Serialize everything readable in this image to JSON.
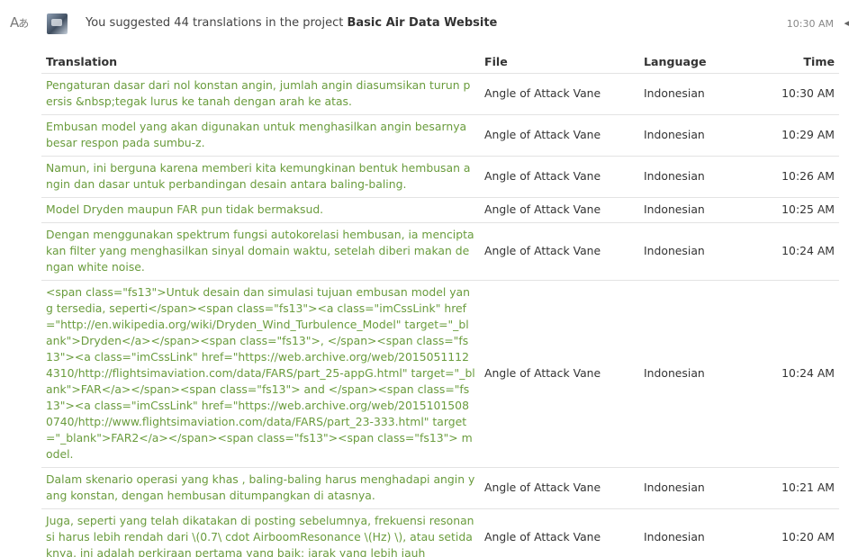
{
  "header": {
    "translate_icon_glyph_a": "A",
    "translate_icon_glyph_b": "あ",
    "headline_prefix": "You suggested 44 translations in the project ",
    "project_name": "Basic Air Data Website",
    "time": "10:30 AM"
  },
  "table": {
    "columns": {
      "translation": "Translation",
      "file": "File",
      "language": "Language",
      "time": "Time"
    },
    "rows": [
      {
        "translation": "Pengaturan dasar dari nol konstan angin, jumlah angin diasumsikan turun persis &nbsp;tegak lurus ke tanah dengan arah ke atas.",
        "file": "Angle of Attack Vane",
        "language": "Indonesian",
        "time": "10:30 AM"
      },
      {
        "translation": "Embusan model yang akan digunakan untuk menghasilkan angin besarnya besar respon pada sumbu-z.",
        "file": "Angle of Attack Vane",
        "language": "Indonesian",
        "time": "10:29 AM"
      },
      {
        "translation": "Namun, ini berguna karena memberi kita kemungkinan bentuk hembusan angin dan dasar untuk perbandingan desain antara baling-baling.",
        "file": "Angle of Attack Vane",
        "language": "Indonesian",
        "time": "10:26 AM"
      },
      {
        "translation": "Model Dryden maupun FAR pun tidak bermaksud.",
        "file": "Angle of Attack Vane",
        "language": "Indonesian",
        "time": "10:25 AM"
      },
      {
        "translation": "Dengan menggunakan spektrum fungsi autokorelasi hembusan, ia menciptakan filter yang menghasilkan sinyal domain waktu, setelah diberi makan dengan white noise.",
        "file": "Angle of Attack Vane",
        "language": "Indonesian",
        "time": "10:24 AM"
      },
      {
        "translation": "<span class=\"fs13\">Untuk desain dan simulasi tujuan embusan model yang tersedia, seperti</span><span class=\"fs13\"><a class=\"imCssLink\" href=\"http://en.wikipedia.org/wiki/Dryden_Wind_Turbulence_Model\" target=\"_blank\">Dryden</a></span><span class=\"fs13\">, </span><span class=\"fs13\"><a class=\"imCssLink\" href=\"https://web.archive.org/web/20150511124310/http://flightsimaviation.com/data/FARS/part_25-appG.html\" target=\"_blank\">FAR</a></span><span class=\"fs13\"> and </span><span class=\"fs13\"><a class=\"imCssLink\" href=\"https://web.archive.org/web/20151015080740/http://www.flightsimaviation.com/data/FARS/part_23-333.html\" target=\"_blank\">FAR2</a></span><span class=\"fs13\"><span class=\"fs13\"> model.",
        "file": "Angle of Attack Vane",
        "language": "Indonesian",
        "time": "10:24 AM"
      },
      {
        "translation": "Dalam skenario operasi yang khas , baling-baling harus menghadapi angin yang konstan, dengan hembusan ditumpangkan di atasnya.",
        "file": "Angle of Attack Vane",
        "language": "Indonesian",
        "time": "10:21 AM"
      },
      {
        "translation": "Juga, seperti yang telah dikatakan di posting sebelumnya, frekuensi resonansi harus lebih rendah dari \\(0.7\\ cdot AirboomResonance \\(Hz) \\), atau setidaknya, ini adalah perkiraan pertama yang baik; jarak yang lebih jauh",
        "file": "Angle of Attack Vane",
        "language": "Indonesian",
        "time": "10:20 AM"
      }
    ]
  }
}
